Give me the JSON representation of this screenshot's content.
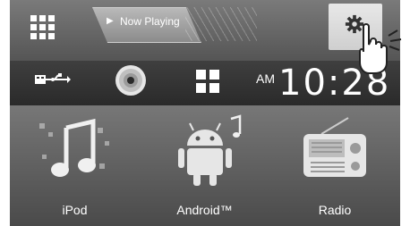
{
  "topbar": {
    "now_playing_label": "Now Playing"
  },
  "clock": {
    "ampm": "AM",
    "time": "10:28"
  },
  "sources": [
    {
      "label": "iPod"
    },
    {
      "label": "Android™"
    },
    {
      "label": "Radio"
    }
  ],
  "icons": {
    "menu": "grid-icon",
    "settings": "gear-icon",
    "usb": "usb-icon",
    "disc": "disc-icon",
    "apps": "apps-icon",
    "pointer": "hand-pointer-icon"
  },
  "colors": {
    "background": "#5d5d5d",
    "text": "#ffffff"
  }
}
